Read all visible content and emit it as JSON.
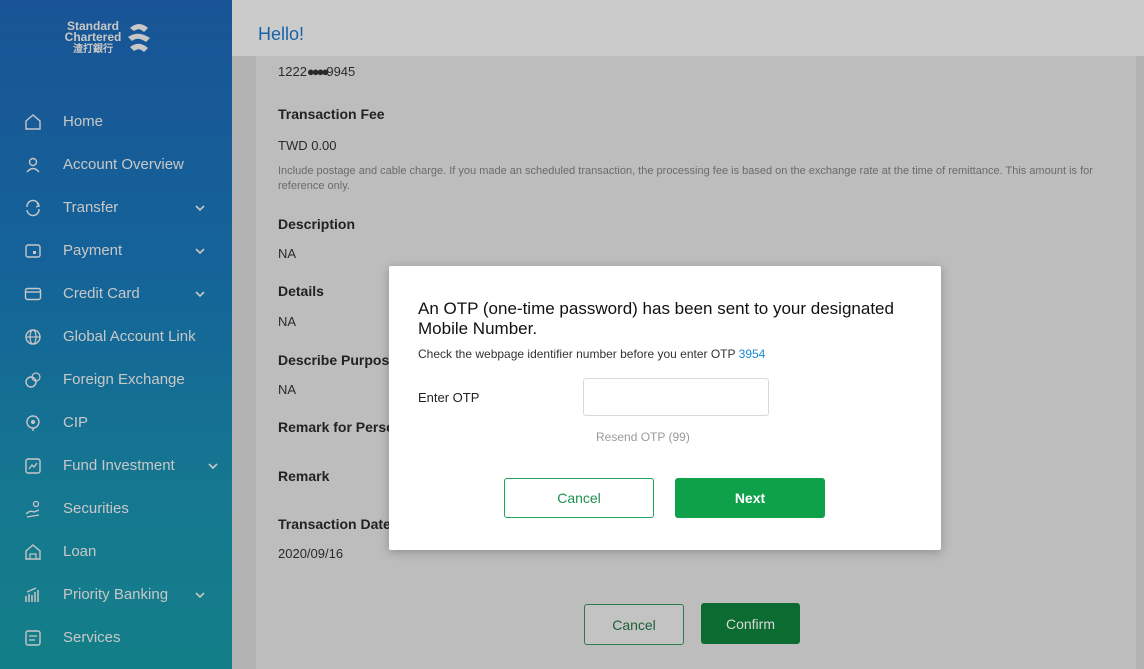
{
  "sidebar": {
    "logo": {
      "line1": "Standard",
      "line2": "Chartered",
      "line3": "渣打銀行"
    },
    "items": [
      {
        "label": "Home",
        "icon": "home-icon",
        "chevron": false
      },
      {
        "label": "Account Overview",
        "icon": "user-icon",
        "chevron": false
      },
      {
        "label": "Transfer",
        "icon": "transfer-icon",
        "chevron": true
      },
      {
        "label": "Payment",
        "icon": "payment-icon",
        "chevron": true
      },
      {
        "label": "Credit Card",
        "icon": "credit-card-icon",
        "chevron": true
      },
      {
        "label": "Global Account Link",
        "icon": "globe-icon",
        "chevron": false
      },
      {
        "label": "Foreign Exchange",
        "icon": "exchange-icon",
        "chevron": false
      },
      {
        "label": "CIP",
        "icon": "cip-icon",
        "chevron": false
      },
      {
        "label": "Fund Investment",
        "icon": "chart-icon",
        "chevron": true
      },
      {
        "label": "Securities",
        "icon": "securities-icon",
        "chevron": false
      },
      {
        "label": "Loan",
        "icon": "loan-icon",
        "chevron": false
      },
      {
        "label": "Priority Banking",
        "icon": "priority-icon",
        "chevron": true
      },
      {
        "label": "Services",
        "icon": "services-icon",
        "chevron": false
      }
    ]
  },
  "header": {
    "greeting": "Hello!"
  },
  "details": {
    "account_prefix": "1222",
    "account_suffix": "9945",
    "fee_label": "Transaction Fee",
    "fee_value": "TWD 0.00",
    "fee_note": "Include postage and cable charge. If you made an scheduled transaction, the processing fee is based on the exchange rate at the time of remittance. This amount is for reference only.",
    "description_label": "Description",
    "description_value": "NA",
    "details_label": "Details",
    "details_value": "NA",
    "purpose_label": "Describe Purpose",
    "purpose_value": "NA",
    "remark_personal_label": "Remark for Personal",
    "remark_label": "Remark",
    "date_label": "Transaction Date",
    "date_value": "2020/09/16",
    "cancel_label": "Cancel",
    "confirm_label": "Confirm"
  },
  "otp_modal": {
    "title": "An OTP (one-time password) has been sent to your designated Mobile Number.",
    "subtitle": "Check the webpage identifier number before you enter OTP",
    "identifier": "3954",
    "input_label": "Enter OTP",
    "input_value": "",
    "resend_label": "Resend OTP (99)",
    "cancel_label": "Cancel",
    "next_label": "Next"
  },
  "colors": {
    "accent_green": "#0fa04a",
    "link_blue": "#1a88d4",
    "sidebar_blue": "#1f6cc0"
  }
}
